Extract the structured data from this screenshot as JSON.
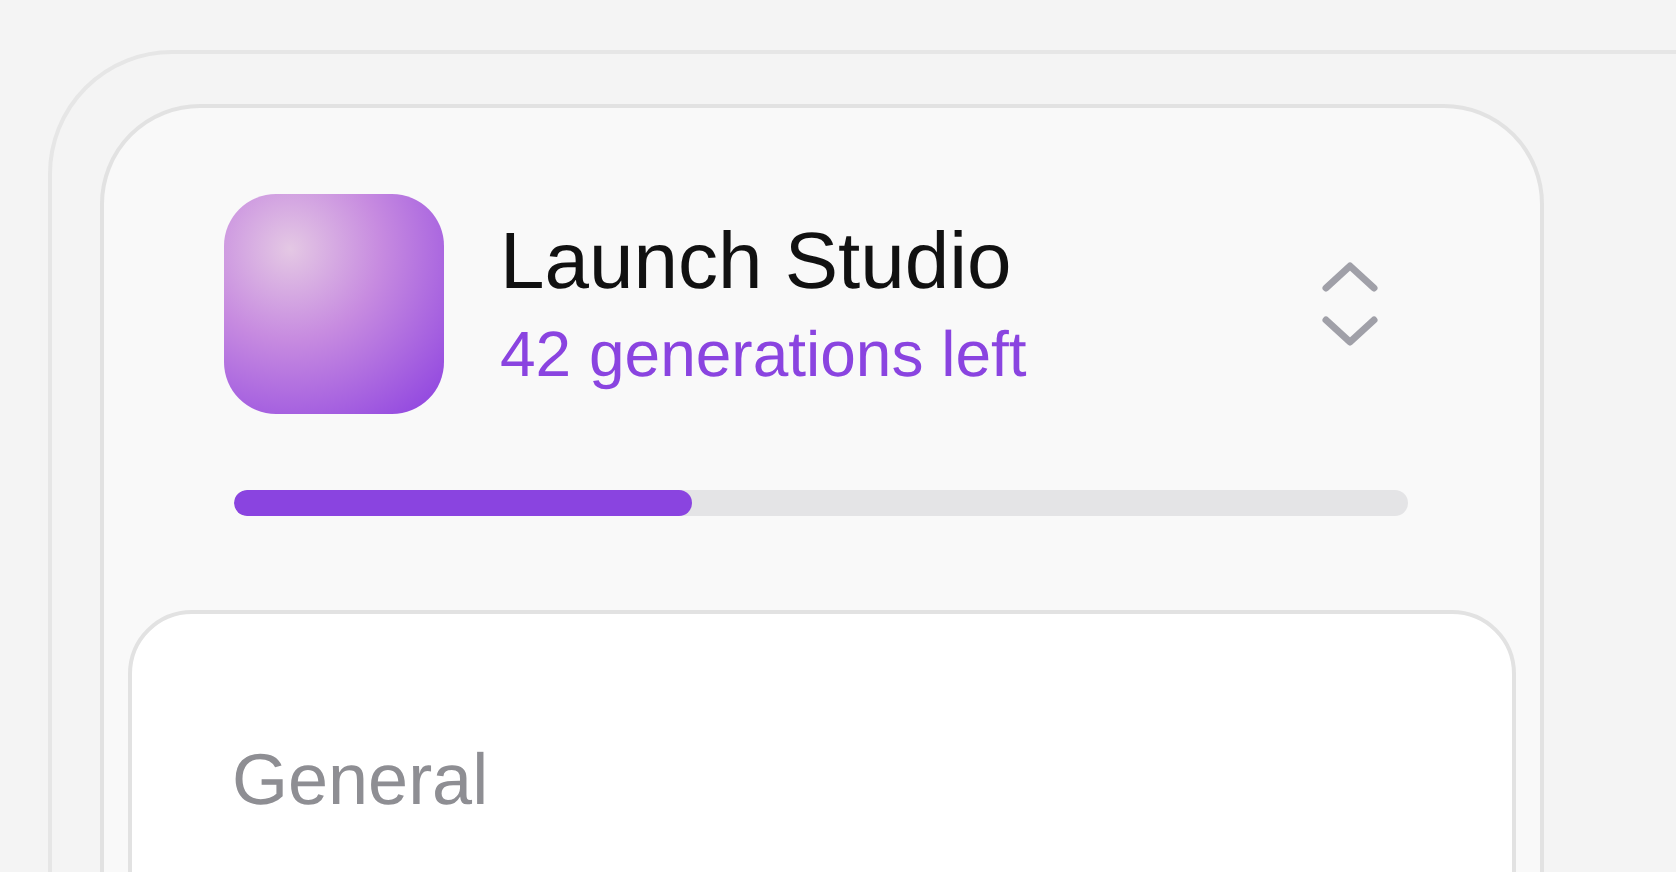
{
  "workspace": {
    "name": "Launch Studio",
    "usage": "42 generations left",
    "level": 0.39
  },
  "section": {
    "title": "General"
  }
}
